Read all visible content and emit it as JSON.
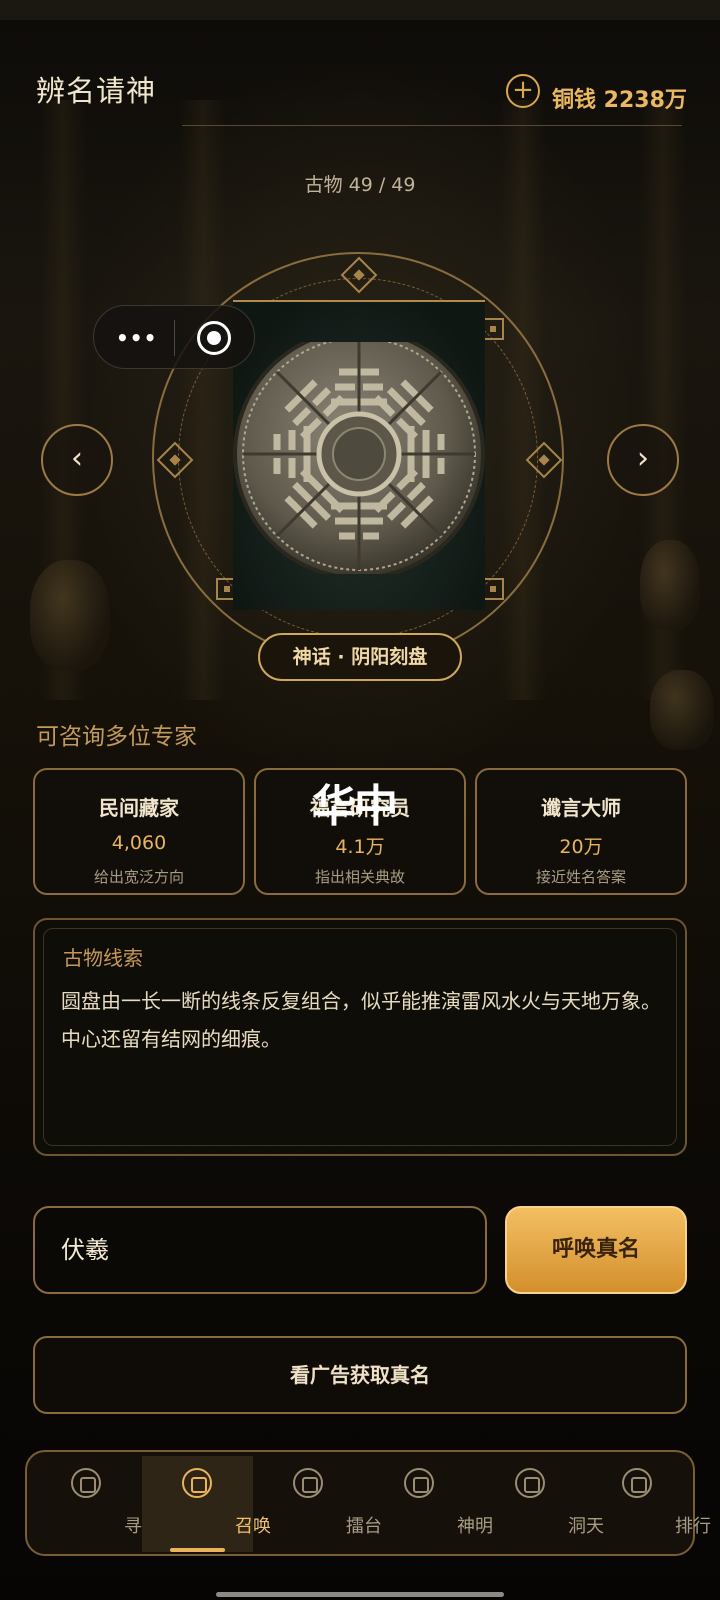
{
  "header": {
    "title": "辨名请神",
    "add_icon": "plus-circle-icon",
    "currency": "铜钱 2238万"
  },
  "artifact": {
    "counter": "古物 49 / 49",
    "name": "神话 · 阴阳刻盘",
    "image": "bagua-disc"
  },
  "nav": {
    "prev": "‹",
    "next": "›"
  },
  "capsule": {
    "more": "•••"
  },
  "experts": {
    "heading": "可咨询多位专家",
    "overlay": "华中",
    "items": [
      {
        "name": "民间藏家",
        "value": "4,060",
        "desc": "给出宽泛方向"
      },
      {
        "name": "福言研究员",
        "value": "4.1万",
        "desc": "指出相关典故"
      },
      {
        "name": "谶言大师",
        "value": "20万",
        "desc": "接近姓名答案"
      }
    ]
  },
  "clue": {
    "title": "古物线索",
    "text": "圆盘由一长一断的线条反复组合，似乎能推演雷风水火与天地万象。中心还留有结网的细痕。"
  },
  "answer": {
    "input_value": "伏羲",
    "summon_label": "呼唤真名",
    "ad_label": "看广告获取真名"
  },
  "tabs": [
    {
      "label": "寻宝",
      "icon": "treasure-icon"
    },
    {
      "label": "召唤",
      "icon": "summon-icon",
      "active": true
    },
    {
      "label": "擂台",
      "icon": "arena-icon"
    },
    {
      "label": "神明",
      "icon": "deity-icon"
    },
    {
      "label": "洞天",
      "icon": "cave-icon"
    },
    {
      "label": "排行",
      "icon": "ranking-icon"
    }
  ],
  "colors": {
    "accent": "#e9b45a",
    "border": "#8b6b3d",
    "background": "#0d0a06"
  }
}
